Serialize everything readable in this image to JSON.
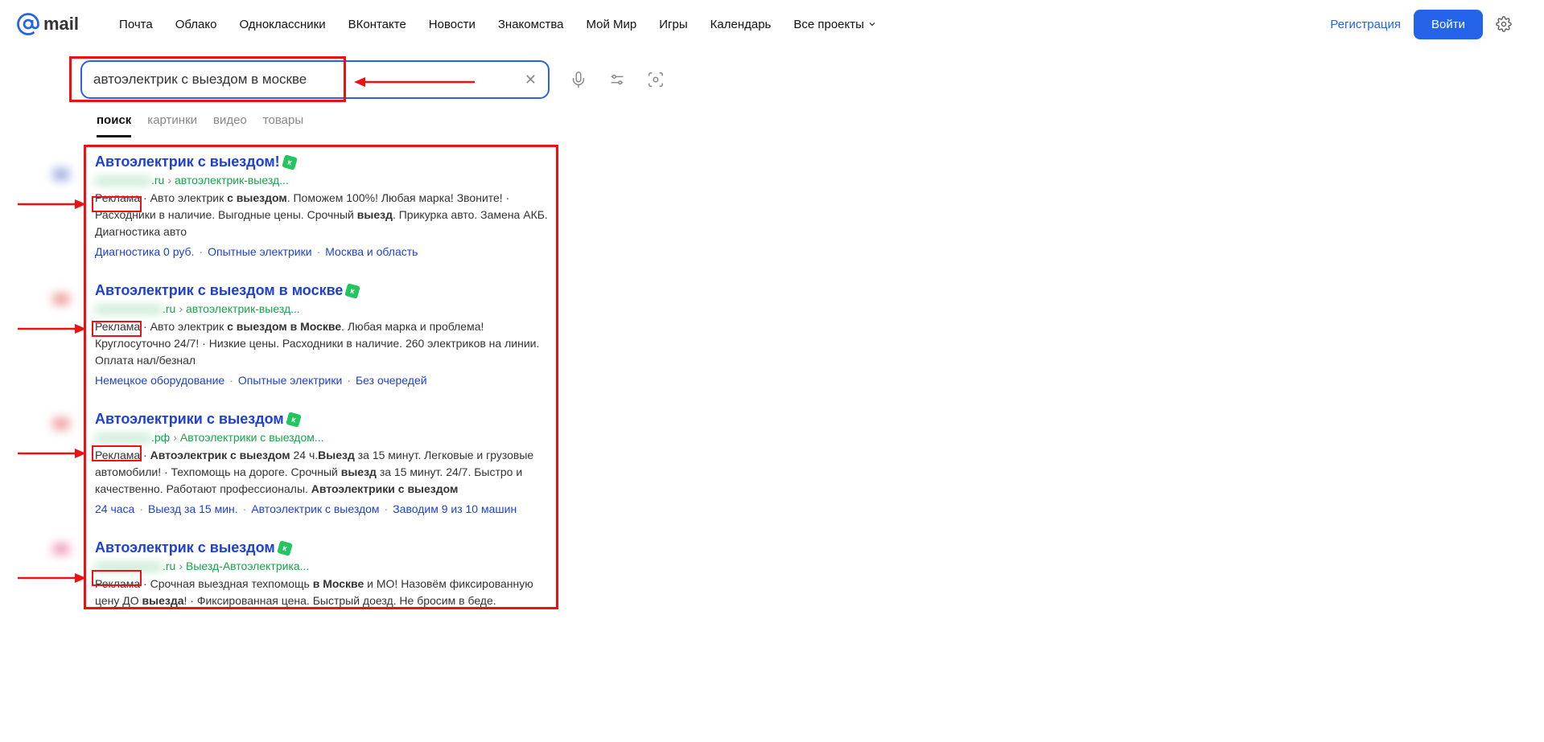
{
  "header": {
    "logo_text": "mail",
    "nav": [
      "Почта",
      "Облако",
      "Одноклассники",
      "ВКонтакте",
      "Новости",
      "Знакомства",
      "Мой Мир",
      "Игры",
      "Календарь",
      "Все проекты"
    ],
    "register": "Регистрация",
    "login": "Войти"
  },
  "search": {
    "query": "автоэлектрик с выездом в москве",
    "tabs": [
      "поиск",
      "картинки",
      "видео",
      "товары"
    ],
    "active_tab": 0
  },
  "results": [
    {
      "title": "Автоэлектрик с выездом!",
      "url_domain_suffix": ".ru",
      "url_path": "автоэлектрик-выезд...",
      "ad_label": "Реклама",
      "desc_prefix": " · Авто электрик ",
      "desc_bold1": "с выездом",
      "desc_mid": ". Поможем 100%! Любая марка! Звоните! · Расходники в наличие. Выгодные цены. Срочный ",
      "desc_bold2": "выезд",
      "desc_suffix": ". Прикурка авто. Замена АКБ. Диагностика авто",
      "links": [
        "Диагностика 0 руб.",
        "Опытные электрики",
        "Москва и область"
      ]
    },
    {
      "title": "Автоэлектрик с выездом в москве",
      "url_domain_suffix": ".ru",
      "url_path": "автоэлектрик-выезд...",
      "ad_label": "Реклама",
      "desc_prefix": " · Авто электрик ",
      "desc_bold1": "с выездом в Москве",
      "desc_mid": ". Любая марка и проблема! Круглосуточно 24/7! · Низкие цены. Расходники в наличие. 260 электриков на линии. Оплата нал/безнал",
      "desc_bold2": "",
      "desc_suffix": "",
      "links": [
        "Немецкое оборудование",
        "Опытные электрики",
        "Без очередей"
      ]
    },
    {
      "title": "Автоэлектрики с выездом",
      "url_domain_suffix": ".рф",
      "url_path": "Автоэлектрики с выездом...",
      "ad_label": "Реклама",
      "desc_prefix": " · ",
      "desc_bold1": "Автоэлектрик с выездом",
      "desc_mid": " 24 ч.",
      "desc_bold2": "Выезд",
      "desc_suffix": " за 15 минут. Легковые и грузовые автомобили! · Техпомощь на дороге. Срочный ",
      "desc_bold3": "выезд",
      "desc_tail": " за 15 минут. 24/7. Быстро и качественно. Работают профессионалы. ",
      "desc_bold4": "Автоэлектрики с выездом",
      "links": [
        "24 часа",
        "Выезд за 15 мин.",
        "Автоэлектрик с выездом",
        "Заводим 9 из 10 машин"
      ]
    },
    {
      "title": "Автоэлектрик с выездом",
      "url_domain_suffix": ".ru",
      "url_path": "Выезд-Автоэлектрика...",
      "ad_label": "Реклама",
      "desc_prefix": " · Срочная выездная техпомощь ",
      "desc_bold1": "в Москве",
      "desc_mid": " и МО! Назовём фиксированную цену ДО ",
      "desc_bold2": "выезда",
      "desc_suffix": "! · Фиксированная цена. Быстрый доезд. Не бросим в беде.",
      "links": []
    }
  ]
}
